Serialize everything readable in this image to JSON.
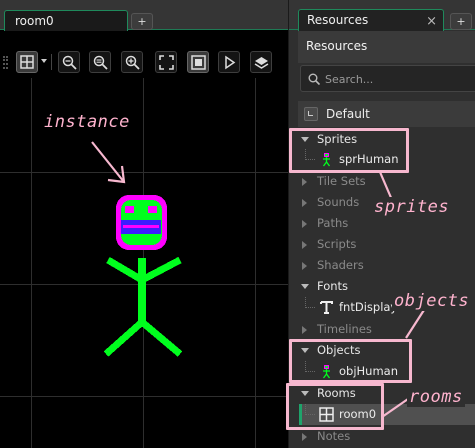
{
  "room_tab": {
    "title": "room0",
    "add": "+"
  },
  "resources_tab": {
    "title": "Resources",
    "close": "×",
    "add": "+"
  },
  "resources_header": "Resources",
  "search": {
    "placeholder": "Search..."
  },
  "default_group": "Default",
  "tree": {
    "sprites": {
      "label": "Sprites",
      "items": [
        "sprHuman"
      ]
    },
    "tile_sets": {
      "label": "Tile Sets"
    },
    "sounds": {
      "label": "Sounds"
    },
    "paths": {
      "label": "Paths"
    },
    "scripts": {
      "label": "Scripts"
    },
    "shaders": {
      "label": "Shaders"
    },
    "fonts": {
      "label": "Fonts",
      "items": [
        "fntDisplay"
      ]
    },
    "timelines": {
      "label": "Timelines"
    },
    "objects": {
      "label": "Objects",
      "items": [
        "objHuman"
      ]
    },
    "rooms": {
      "label": "Rooms",
      "items": [
        "room0"
      ]
    },
    "notes": {
      "label": "Notes"
    }
  },
  "annotations": {
    "instance": "instance",
    "sprites": "sprites",
    "objects": "objects",
    "rooms": "rooms"
  },
  "colors": {
    "accent": "#1f8a5c",
    "annotation": "#f7b8cf",
    "figure_body": "#00ff1e",
    "figure_outline": "#ff00ff",
    "figure_face": "#3c1cff"
  }
}
